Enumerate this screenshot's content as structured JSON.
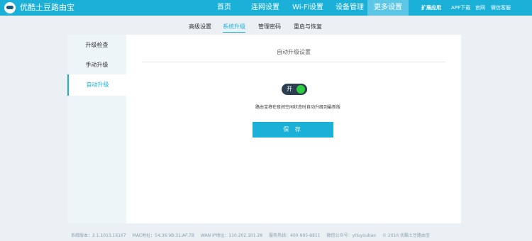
{
  "header": {
    "brand": "优酷土豆路由宝",
    "nav": [
      "首页",
      "连网设置",
      "Wi-Fi设置",
      "设备管理",
      "更多设置"
    ],
    "active_nav": "更多设置",
    "extra_links": [
      "扩展应用",
      "APP下载",
      "官网",
      "微信客服"
    ]
  },
  "subtabs": {
    "items": [
      "高级设置",
      "系统升级",
      "管理密码",
      "重启与恢复"
    ],
    "active": "系统升级"
  },
  "sidebar": {
    "items": [
      "升级检查",
      "手动升级",
      "自动升级"
    ],
    "active": "自动升级"
  },
  "main": {
    "section_title": "自动升级设置",
    "toggle_label": "开",
    "toggle_on": true,
    "description": "路由宝将在夜间空闲状态时自动升级到最新版",
    "save_label": "保 存"
  },
  "footer": {
    "version": "系统版本：2.1.1013.16167",
    "mac": "MAC地址：54:36:9B:31:AF:7B",
    "wan_ip": "WAN IP地址：110.202.101.28",
    "hotline": "服务热线：400-905-8811",
    "wechat": "微信公众号：ytluyoubao",
    "copyright": "© 2016 优酷土豆路由宝"
  },
  "colors": {
    "accent": "#1ab0d8",
    "toggle_bg": "#2c3e50",
    "toggle_knob": "#2ecc40"
  }
}
